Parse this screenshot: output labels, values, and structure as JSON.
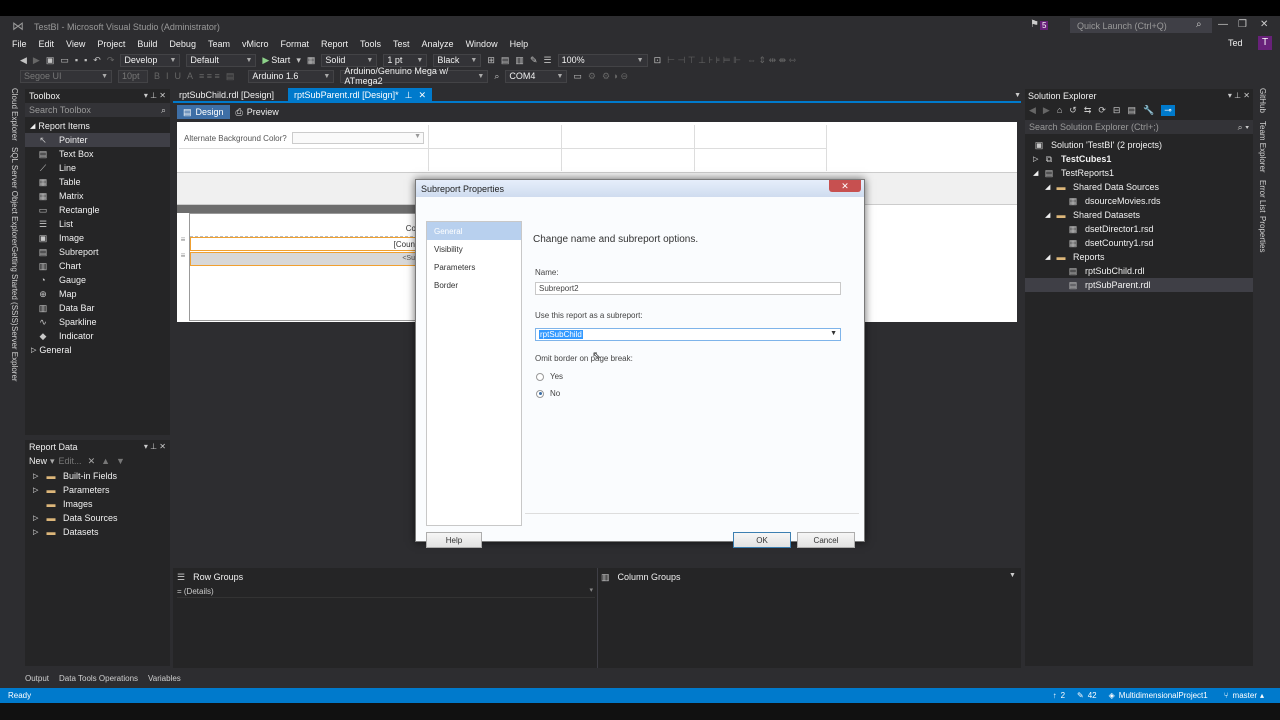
{
  "window": {
    "title": "TestBI - Microsoft Visual Studio (Administrator)",
    "notification_count": "5",
    "quick_launch_placeholder": "Quick Launch (Ctrl+Q)",
    "user": "Ted",
    "user_initial": "T"
  },
  "menu": [
    "File",
    "Edit",
    "View",
    "Project",
    "Build",
    "Debug",
    "Team",
    "vMicro",
    "Format",
    "Report",
    "Tools",
    "Test",
    "Analyze",
    "Window",
    "Help"
  ],
  "toolbar1": {
    "config": "Develop",
    "platform": "Default",
    "start": "Start",
    "line_style": "Solid",
    "line_width": "1 pt",
    "line_color": "Black",
    "zoom": "100%"
  },
  "toolbar2": {
    "font": "Segoe UI",
    "font_size": "10pt",
    "board": "Arduino 1.6",
    "target": "Arduino/Genuino Mega w/ ATmega2",
    "port": "COM4"
  },
  "side_tabs_left": [
    "Cloud Explorer",
    "SQL Server Object Explorer",
    "Getting Started (SSIS)",
    "Server Explorer"
  ],
  "side_tabs_right": [
    "GitHub",
    "Team Explorer",
    "Error List",
    "Properties"
  ],
  "toolbox": {
    "title": "Toolbox",
    "search_placeholder": "Search Toolbox",
    "group": "Report Items",
    "items": [
      {
        "label": "Pointer",
        "icon": "pointer-icon",
        "glyph": "↖"
      },
      {
        "label": "Text Box",
        "icon": "textbox-icon",
        "glyph": "▤"
      },
      {
        "label": "Line",
        "icon": "line-icon",
        "glyph": "⟋"
      },
      {
        "label": "Table",
        "icon": "table-icon",
        "glyph": "▦"
      },
      {
        "label": "Matrix",
        "icon": "matrix-icon",
        "glyph": "▦"
      },
      {
        "label": "Rectangle",
        "icon": "rectangle-icon",
        "glyph": "▭"
      },
      {
        "label": "List",
        "icon": "list-icon",
        "glyph": "☰"
      },
      {
        "label": "Image",
        "icon": "image-icon",
        "glyph": "▣"
      },
      {
        "label": "Subreport",
        "icon": "subreport-icon",
        "glyph": "▤"
      },
      {
        "label": "Chart",
        "icon": "chart-icon",
        "glyph": "▥"
      },
      {
        "label": "Gauge",
        "icon": "gauge-icon",
        "glyph": "◔"
      },
      {
        "label": "Map",
        "icon": "map-icon",
        "glyph": "⊕"
      },
      {
        "label": "Data Bar",
        "icon": "databar-icon",
        "glyph": "▥"
      },
      {
        "label": "Sparkline",
        "icon": "sparkline-icon",
        "glyph": "∿"
      },
      {
        "label": "Indicator",
        "icon": "indicator-icon",
        "glyph": "◆"
      }
    ],
    "general": "General"
  },
  "report_data": {
    "title": "Report Data",
    "new_label": "New",
    "edit_label": "Edit...",
    "items": [
      "Built-in Fields",
      "Parameters",
      "Images",
      "Data Sources",
      "Datasets"
    ]
  },
  "doc_tabs": [
    {
      "label": "rptSubChild.rdl [Design]"
    },
    {
      "label": "rptSubParent.rdl [Design]*"
    }
  ],
  "design_tabs": {
    "design": "Design",
    "preview": "Preview"
  },
  "report_canvas": {
    "alt_bg_label": "Alternate Background Color?",
    "cell_header": "Co",
    "cell_expr": "[Coun",
    "cell_sub": "<Su"
  },
  "dialog": {
    "title": "Subreport Properties",
    "nav": [
      "General",
      "Visibility",
      "Parameters",
      "Border"
    ],
    "heading": "Change name and subreport options.",
    "name_label": "Name:",
    "name_value": "Subreport2",
    "use_label": "Use this report as a subreport:",
    "use_value": "rptSubChild",
    "omit_label": "Omit border on page break:",
    "yes": "Yes",
    "no": "No",
    "selected_option": "No",
    "help": "Help",
    "ok": "OK",
    "cancel": "Cancel"
  },
  "groups": {
    "row_groups": "Row Groups",
    "column_groups": "Column Groups",
    "details": "= (Details)"
  },
  "solution_explorer": {
    "title": "Solution Explorer",
    "search_placeholder": "Search Solution Explorer (Ctrl+;)",
    "items": [
      {
        "label": "Solution 'TestBI' (2 projects)"
      },
      {
        "label": "TestCubes1"
      },
      {
        "label": "TestReports1"
      },
      {
        "label": "Shared Data Sources"
      },
      {
        "label": "dsourceMovies.rds"
      },
      {
        "label": "Shared Datasets"
      },
      {
        "label": "dsetDirector1.rsd"
      },
      {
        "label": "dsetCountry1.rsd"
      },
      {
        "label": "Reports"
      },
      {
        "label": "rptSubChild.rdl"
      },
      {
        "label": "rptSubParent.rdl"
      }
    ]
  },
  "bottom_tabs": [
    "Output",
    "Data Tools Operations",
    "Variables"
  ],
  "status": {
    "ready": "Ready",
    "up_count": "2",
    "edit_count": "42",
    "project": "MultidimensionalProject1",
    "branch": "master"
  },
  "colors": {
    "accent": "#007acc",
    "badge": "#68217a",
    "dialog_close": "#c75050"
  }
}
